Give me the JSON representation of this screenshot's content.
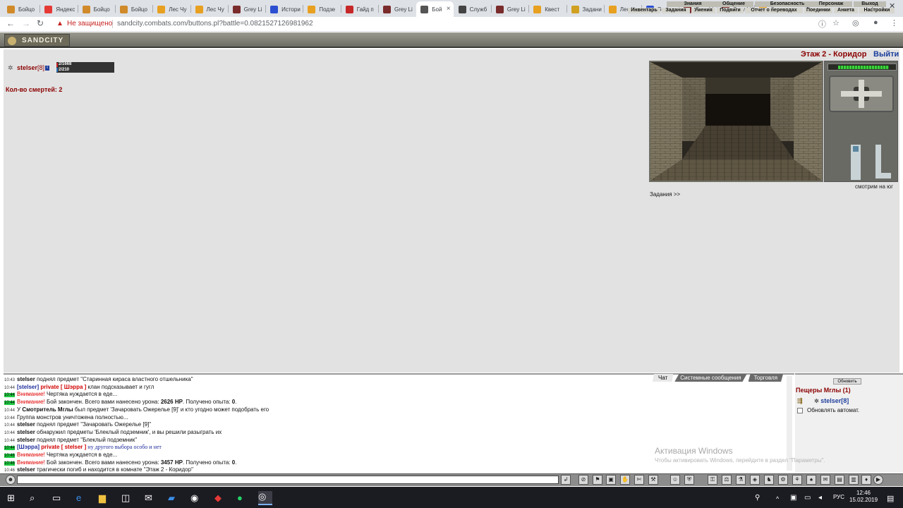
{
  "browser": {
    "tabs": [
      {
        "label": "Бойцо",
        "fav": "#d08a2a"
      },
      {
        "label": "Яндекс",
        "fav": "#e53935"
      },
      {
        "label": "Бойцо",
        "fav": "#d08a2a"
      },
      {
        "label": "Бойцо",
        "fav": "#d08a2a"
      },
      {
        "label": "Лес Чу",
        "fav": "#e8a020"
      },
      {
        "label": "Лес Чу",
        "fav": "#e8a020"
      },
      {
        "label": "Grey Li",
        "fav": "#7a2b2b"
      },
      {
        "label": "Истори",
        "fav": "#2b4fd0"
      },
      {
        "label": "Подзе",
        "fav": "#e8a020"
      },
      {
        "label": "Гайд п",
        "fav": "#c62828"
      },
      {
        "label": "Grey Li",
        "fav": "#7a2b2b"
      },
      {
        "label": "Бой",
        "fav": "#555555",
        "active": true
      },
      {
        "label": "Служб",
        "fav": "#444444"
      },
      {
        "label": "Grey Li",
        "fav": "#7a2b2b"
      },
      {
        "label": "Квест",
        "fav": "#e8a020"
      },
      {
        "label": "Задани",
        "fav": "#d0a020"
      },
      {
        "label": "Лес Чу",
        "fav": "#e8a020"
      },
      {
        "label": "Вещи",
        "fav": "#2b4fd0"
      },
      {
        "label": "Grey Li",
        "fav": "#7a2b2b"
      },
      {
        "label": "Grey Li",
        "fav": "#7a2b2b"
      },
      {
        "label": "День",
        "fav": "#e8a020"
      }
    ],
    "new_tab": "+",
    "window_controls": [
      "–",
      "❐",
      "✕"
    ],
    "not_secure": "Не защищено",
    "url": "sandcity.combats.com/buttons.pl?battle=0.0821527126981962"
  },
  "game": {
    "logo": "SANDCITY",
    "menu_top": [
      "Знания",
      "Общение",
      "Безопасность",
      "Персонаж",
      "Выход"
    ],
    "menu_bottom": [
      "Инвентарь",
      "Задания",
      "Умения",
      "Подвиги",
      "Отчет о переводах",
      "Поединки",
      "Анкета",
      "Настройки"
    ],
    "room_title": "Этаж 2 - Коридор",
    "exit_label": "Выйти",
    "player": {
      "name": "stelser",
      "level": "[8]",
      "hp": "2/1668",
      "hp_highlight": "2",
      "mp": "2/210",
      "mp_highlight": "2",
      "hp_fraction": 0.0012,
      "mp_fraction": 0.0095
    },
    "deaths": "Кол-во смертей: 2",
    "facing": "смотрим на юг",
    "quests": "Задания >>"
  },
  "chat": {
    "tabs": [
      "Чат",
      "Системные сообщения",
      "Торговля"
    ],
    "lines": [
      {
        "time": "10:43",
        "hl": false,
        "who": "stelser",
        "text": " поднял предмет \"Старинная кираса властного отшельника\""
      },
      {
        "time": "10:44",
        "hl": false,
        "bracket": "[stelser]",
        "priv": "private [ Шэрра ]",
        "text": " клан подсказывает и гугл"
      },
      {
        "time": "10:44",
        "hl": true,
        "warn": "Внимание!",
        "text": " Чертяка нуждается в еде..."
      },
      {
        "time": "10:44",
        "hl": true,
        "warn": "Внимание!",
        "text": " Бой закончен. Всего вами нанесено урона: ",
        "b1": "2626 HP",
        "t2": ". Получено опыта: ",
        "b2": "0",
        "t3": "."
      },
      {
        "time": "10:44",
        "hl": false,
        "pre": "У ",
        "who": "Смотритель Мглы",
        "text": " был предмет 'Зачаровать Ожерелье [9]' и кто угодно может подобрать его"
      },
      {
        "time": "10:44",
        "hl": false,
        "text": "Группа монстров уничтожена полностью..."
      },
      {
        "time": "10:44",
        "hl": false,
        "who": "stelser",
        "text": " поднял предмет \"Зачаровать Ожерелье [9]\""
      },
      {
        "time": "10:44",
        "hl": false,
        "who": "stelser",
        "text": " обнаружил предметы 'Блеклый подземник', и вы решили разыграть их"
      },
      {
        "time": "10:44",
        "hl": false,
        "who": "stelser",
        "text": " поднял предмет \"Блеклый подземник\""
      },
      {
        "time": "10:44",
        "hl": true,
        "bracket": "[Шэрра]",
        "priv": "private [ stelser ]",
        "blue": " ну другого выбора особо и нет"
      },
      {
        "time": "10:46",
        "hl": true,
        "warn": "Внимание!",
        "text": " Чертяка нуждается в еде..."
      },
      {
        "time": "10:46",
        "hl": true,
        "warn": "Внимание!",
        "text": " Бой закончен. Всего вами нанесено урона: ",
        "b1": "3457 HP",
        "t2": ". Получено опыта: ",
        "b2": "0",
        "t3": "."
      },
      {
        "time": "10:46",
        "hl": false,
        "who": "stelser",
        "text": " трагически погиб и находится в комнате \"Этаж 2 - Коридор\""
      }
    ]
  },
  "side": {
    "refresh": "Обновить",
    "location": "Пещеры Мглы (1)",
    "player": "stelser[8]",
    "auto_update": "Обновлять автомат."
  },
  "watermark": {
    "title": "Активация Windows",
    "subtitle": "Чтобы активировать Windows, перейдите в раздел \"Параметры\"."
  },
  "taskbar": {
    "lang": "РУС",
    "time": "12:46",
    "date": "15.02.2019"
  }
}
